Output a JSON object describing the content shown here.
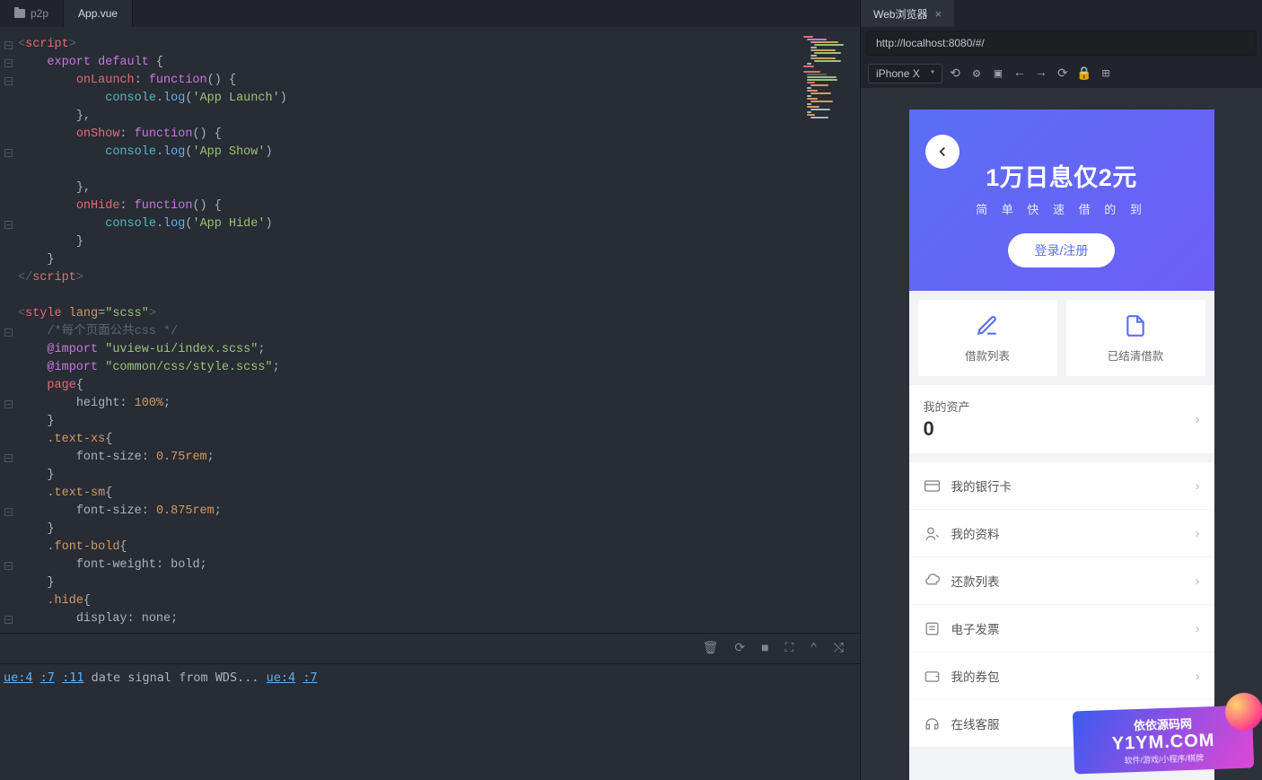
{
  "tabs": {
    "folder": "p2p",
    "file": "App.vue"
  },
  "code": {
    "l1_tag": "script",
    "l2_kw": "export default",
    "l2_b": " {",
    "l3_k": "onLaunch",
    "l3_kw": "function",
    "l4_c": "console",
    "l4_m": "log",
    "l4_s": "'App Launch'",
    "l7_k": "onShow",
    "l8_s": "'App Show'",
    "l11_k": "onHide",
    "l12_s": "'App Hide'",
    "st_tag": "style",
    "st_attr": "lang",
    "st_val": "\"scss\"",
    "cm": "/*每个页面公共css */",
    "imp": "@import",
    "imp1": "\"uview-ui/index.scss\"",
    "imp2": "\"common/css/style.scss\"",
    "sel_page": "page",
    "prop_h": "height",
    "val_h": "100%",
    "sel_xs": ".text-xs",
    "prop_fs": "font-size",
    "val_xs": "0.75rem",
    "sel_sm": ".text-sm",
    "val_sm": "0.875rem",
    "sel_fb": ".font-bold",
    "prop_fw": "font-weight",
    "val_fb": "bold",
    "sel_hd": ".hide",
    "prop_d": "display",
    "val_hd": "none"
  },
  "terminal": {
    "l1": "ue:4",
    "l2": ":7",
    "l3": ":11",
    "l4": "date signal from WDS...",
    "l5": "ue:4",
    "l6": ":7"
  },
  "preview": {
    "tab": "Web浏览器",
    "url": "http://localhost:8080/#/",
    "device": "iPhone X",
    "hero_title": "1万日息仅2元",
    "hero_sub": "简 单 快 速 借 的 到",
    "login": "登录/注册",
    "card1": "借款列表",
    "card2": "已结清借款",
    "asset_t": "我的资产",
    "asset_v": "0",
    "m1": "我的银行卡",
    "m2": "我的资料",
    "m3": "还款列表",
    "m4": "电子发票",
    "m5": "我的券包",
    "m6": "在线客服"
  },
  "wm": {
    "top": "依依源码网",
    "main": "Y1YM.COM",
    "sub": "软件/游戏/小程序/棋牌"
  }
}
